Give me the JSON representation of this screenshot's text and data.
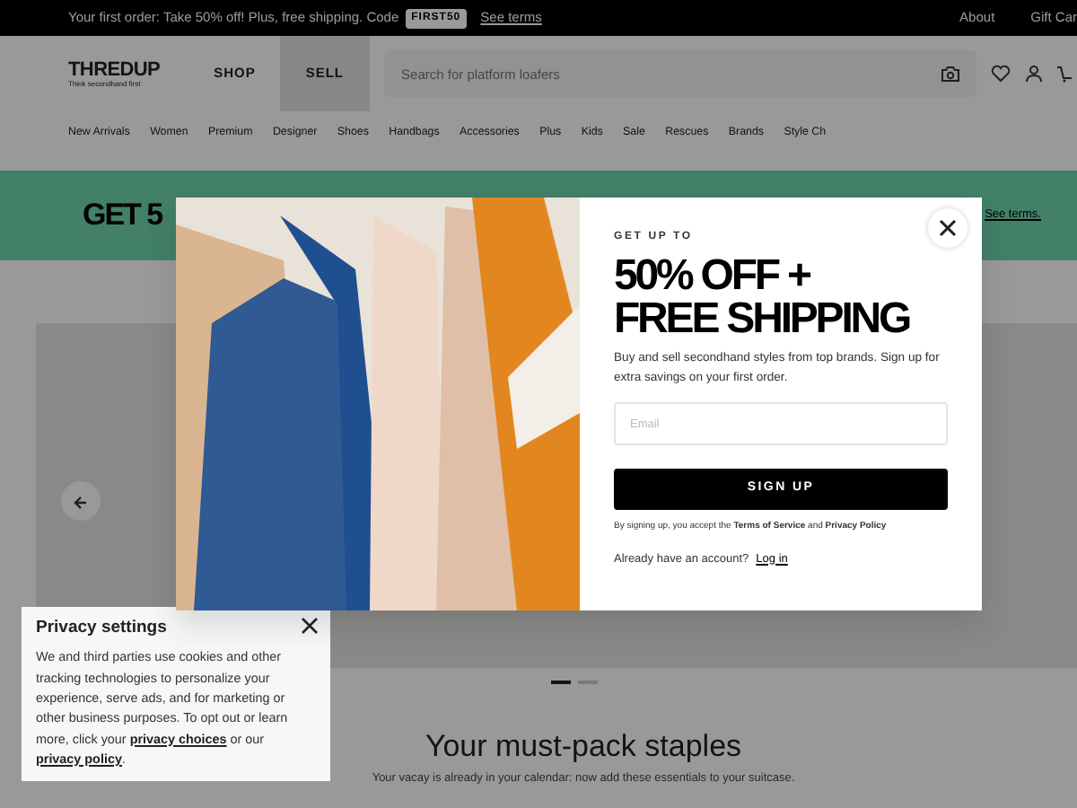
{
  "promo_bar": {
    "text": "Your first order: Take 50% off! Plus, free shipping. Code",
    "code": "FIRST50",
    "link": "See terms",
    "right_links": [
      "About",
      "Gift Car"
    ]
  },
  "header": {
    "logo": "THREDUP",
    "tagline": "Think secondhand first",
    "menu": [
      {
        "label": "SHOP",
        "selected": false
      },
      {
        "label": "SELL",
        "selected": true
      }
    ],
    "search": {
      "placeholder": "Search for platform loafers"
    }
  },
  "categories": [
    "New Arrivals",
    "Women",
    "Premium",
    "Designer",
    "Shoes",
    "Handbags",
    "Accessories",
    "Plus",
    "Kids",
    "Sale",
    "Rescues",
    "Brands",
    "Style Ch"
  ],
  "banner": {
    "headline": "GET 5",
    "link": "See terms."
  },
  "carousel": {
    "dots": [
      {
        "selected": true
      },
      {
        "selected": false
      }
    ]
  },
  "section": {
    "title": "Your must-pack staples",
    "subtitle": "Your vacay is already in your calendar: now add these essentials to your suitcase."
  },
  "privacy": {
    "title": "Privacy settings",
    "segments": [
      {
        "kind": "text",
        "text": "We and third parties use cookies and other tracking technologies to personalize your experience, serve ads, and for marketing or other business purposes. To opt out or learn more, click your "
      },
      {
        "kind": "link",
        "text": "privacy choices"
      },
      {
        "kind": "text",
        "text": " or our "
      },
      {
        "kind": "link",
        "text": "privacy policy"
      },
      {
        "kind": "text",
        "text": "."
      }
    ]
  },
  "modal": {
    "eyebrow": "GET UP TO",
    "headline": [
      "50% OFF +",
      "FREE SHIPPING"
    ],
    "body": "Buy and sell secondhand styles from top brands. Sign up for extra savings on your first order.",
    "email": {
      "placeholder": "Email"
    },
    "button": "SIGN UP",
    "legal": "By signing up, you accept the **Terms of Service** and **Privacy Policy**",
    "account_text": "Already have an account?",
    "login_link": "Log in"
  }
}
